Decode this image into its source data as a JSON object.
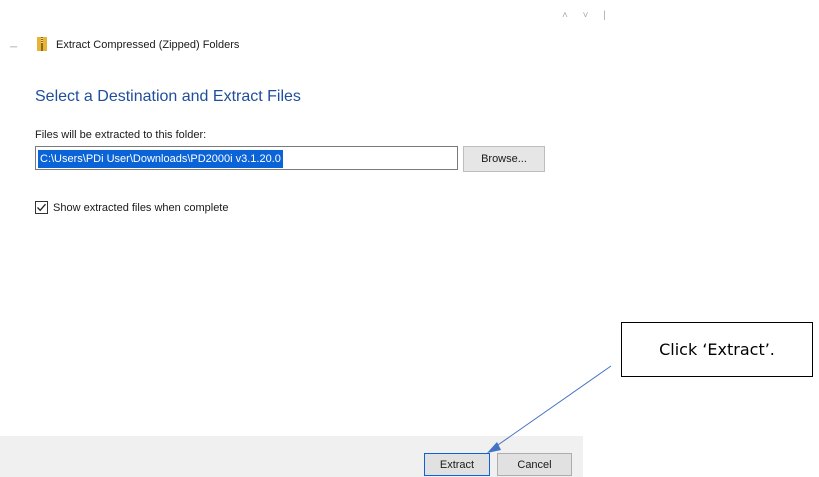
{
  "window": {
    "title": "Extract Compressed (Zipped) Folders",
    "back_glyph": "←",
    "controls": "˄ ˅ |"
  },
  "dialog": {
    "heading": "Select a Destination and Extract Files",
    "path_label": "Files will be extracted to this folder:",
    "path_value": "C:\\Users\\PDi User\\Downloads\\PD2000i v3.1.20.0",
    "browse_label": "Browse...",
    "checkbox_label": "Show extracted files when complete",
    "checkbox_checked": true
  },
  "footer": {
    "extract_label": "Extract",
    "cancel_label": "Cancel"
  },
  "annotation": {
    "text": "Click ‘Extract’."
  },
  "colors": {
    "heading": "#1f4e9c",
    "selection": "#0a64d8",
    "arrow": "#4472c4",
    "footer": "#f0f0f0"
  }
}
